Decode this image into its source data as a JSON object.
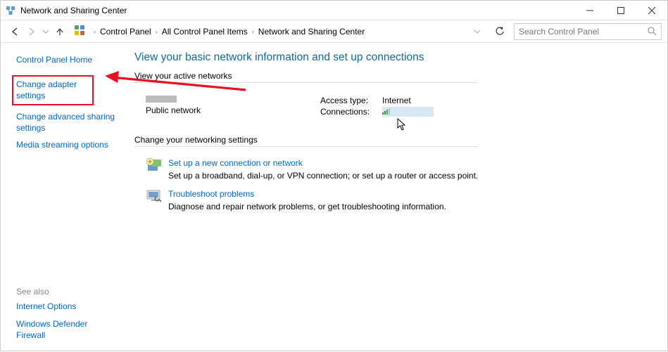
{
  "window": {
    "title": "Network and Sharing Center",
    "minimize": "─",
    "maximize": "▢",
    "close": "✕"
  },
  "toolbar": {
    "breadcrumb": {
      "control_panel": "Control Panel",
      "all_items": "All Control Panel Items",
      "current": "Network and Sharing Center"
    },
    "search_placeholder": "Search Control Panel"
  },
  "sidebar": {
    "home": "Control Panel Home",
    "adapter": "Change adapter settings",
    "advanced": "Change advanced sharing settings",
    "media": "Media streaming options"
  },
  "see_also": {
    "heading": "See also",
    "internet": "Internet Options",
    "firewall": "Windows Defender Firewall"
  },
  "main": {
    "heading": "View your basic network information and set up connections",
    "active_networks_label": "View your active networks",
    "network": {
      "type": "Public network",
      "access_type_label": "Access type:",
      "access_type_value": "Internet",
      "connections_label": "Connections:"
    },
    "change_settings_label": "Change your networking settings",
    "setup": {
      "link": "Set up a new connection or network",
      "desc": "Set up a broadband, dial-up, or VPN connection; or set up a router or access point."
    },
    "troubleshoot": {
      "link": "Troubleshoot problems",
      "desc": "Diagnose and repair network problems, or get troubleshooting information."
    }
  }
}
